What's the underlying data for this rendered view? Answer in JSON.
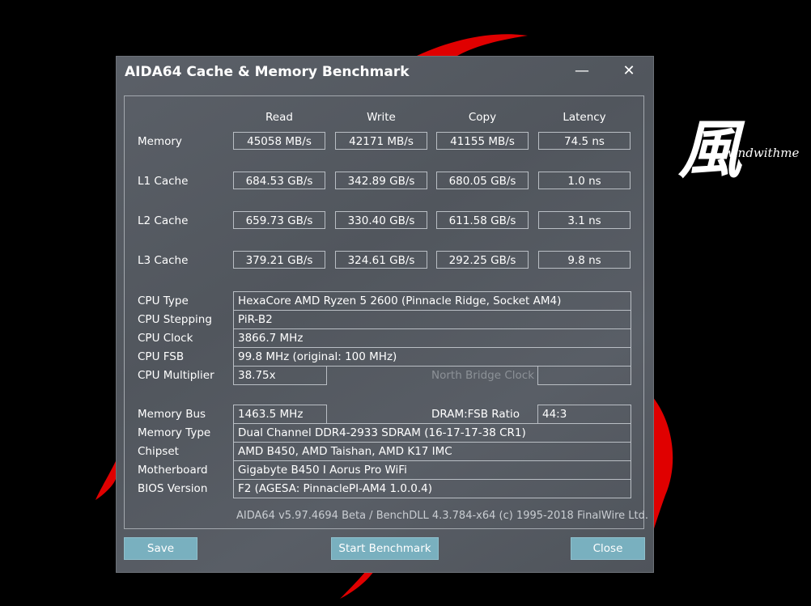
{
  "window": {
    "title": "AIDA64 Cache & Memory Benchmark",
    "minimize_glyph": "—",
    "close_glyph": "✕"
  },
  "logo": {
    "char": "風",
    "text": "windwithme"
  },
  "columns": [
    "Read",
    "Write",
    "Copy",
    "Latency"
  ],
  "benchmarks": [
    {
      "label": "Memory",
      "values": [
        "45058 MB/s",
        "42171 MB/s",
        "41155 MB/s",
        "74.5 ns"
      ]
    },
    {
      "label": "L1 Cache",
      "values": [
        "684.53 GB/s",
        "342.89 GB/s",
        "680.05 GB/s",
        "1.0 ns"
      ]
    },
    {
      "label": "L2 Cache",
      "values": [
        "659.73 GB/s",
        "330.40 GB/s",
        "611.58 GB/s",
        "3.1 ns"
      ]
    },
    {
      "label": "L3 Cache",
      "values": [
        "379.21 GB/s",
        "324.61 GB/s",
        "292.25 GB/s",
        "9.8 ns"
      ]
    }
  ],
  "cpu": {
    "type_label": "CPU Type",
    "type_value": "HexaCore AMD Ryzen 5 2600  (Pinnacle Ridge, Socket AM4)",
    "stepping_label": "CPU Stepping",
    "stepping_value": "PiR-B2",
    "clock_label": "CPU Clock",
    "clock_value": "3866.7 MHz",
    "fsb_label": "CPU FSB",
    "fsb_value": "99.8 MHz  (original: 100 MHz)",
    "multiplier_label": "CPU Multiplier",
    "multiplier_value": "38.75x",
    "nb_clock_label": "North Bridge Clock",
    "nb_clock_value": ""
  },
  "memory": {
    "bus_label": "Memory Bus",
    "bus_value": "1463.5 MHz",
    "ratio_label": "DRAM:FSB Ratio",
    "ratio_value": "44:3",
    "type_label": "Memory Type",
    "type_value": "Dual Channel DDR4-2933 SDRAM  (16-17-17-38 CR1)",
    "chipset_label": "Chipset",
    "chipset_value": "AMD B450, AMD Taishan, AMD K17 IMC",
    "motherboard_label": "Motherboard",
    "motherboard_value": "Gigabyte B450 I Aorus Pro WiFi",
    "bios_label": "BIOS Version",
    "bios_value": "F2  (AGESA: PinnaclePI-AM4 1.0.0.4)"
  },
  "footer": "AIDA64 v5.97.4694 Beta / BenchDLL 4.3.784-x64  (c) 1995-2018 FinalWire Ltd.",
  "buttons": {
    "save": "Save",
    "start": "Start Benchmark",
    "close": "Close"
  },
  "colors": {
    "accent_red": "#e00000",
    "button": "#79b0bf",
    "window_bg": "#565b62"
  }
}
